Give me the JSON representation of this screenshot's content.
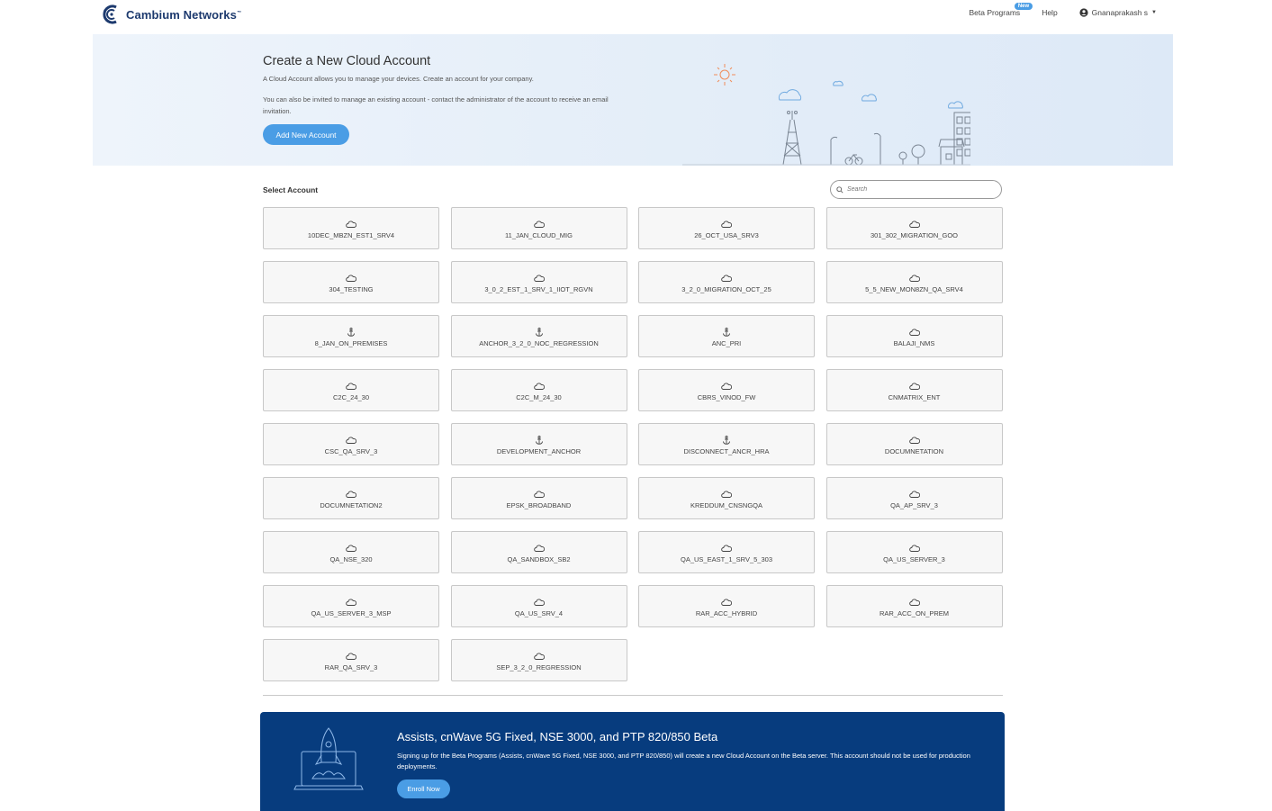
{
  "header": {
    "brand": "Cambium Networks",
    "brand_tm": "™",
    "beta_programs": "Beta Programs",
    "beta_badge": "New",
    "help": "Help",
    "user_name": "Gnanaprakash s"
  },
  "hero": {
    "title": "Create a New Cloud Account",
    "line1": "A Cloud Account allows you to manage your devices. Create an account for your company.",
    "line2": "You can also be invited to manage an existing account - contact the administrator of the account to receive an email invitation.",
    "add_button": "Add New Account"
  },
  "accounts": {
    "label": "Select Account",
    "search_placeholder": "Search",
    "items": [
      {
        "name": "10DEC_MBZN_EST1_SRV4",
        "icon": "cloud-icon"
      },
      {
        "name": "11_JAN_CLOUD_MIG",
        "icon": "cloud-icon"
      },
      {
        "name": "26_OCT_USA_SRV3",
        "icon": "cloud-icon"
      },
      {
        "name": "301_302_MIGRATION_GOO",
        "icon": "cloud-icon"
      },
      {
        "name": "304_TESTING",
        "icon": "cloud-icon"
      },
      {
        "name": "3_0_2_EST_1_SRV_1_IIOT_RGVN",
        "icon": "cloud-icon"
      },
      {
        "name": "3_2_0_MIGRATION_OCT_25",
        "icon": "cloud-icon"
      },
      {
        "name": "5_5_NEW_MON8ZN_QA_SRV4",
        "icon": "cloud-icon"
      },
      {
        "name": "8_JAN_ON_PREMISES",
        "icon": "anchor-icon"
      },
      {
        "name": "ANCHOR_3_2_0_NOC_REGRESSION",
        "icon": "anchor-icon"
      },
      {
        "name": "ANC_PRI",
        "icon": "anchor-icon"
      },
      {
        "name": "BALAJI_NMS",
        "icon": "cloud-icon"
      },
      {
        "name": "C2C_24_30",
        "icon": "cloud-icon"
      },
      {
        "name": "C2C_M_24_30",
        "icon": "cloud-icon"
      },
      {
        "name": "CBRS_VINOD_FW",
        "icon": "cloud-icon"
      },
      {
        "name": "CNMATRIX_ENT",
        "icon": "cloud-icon"
      },
      {
        "name": "CSC_QA_SRV_3",
        "icon": "cloud-icon"
      },
      {
        "name": "DEVELOPMENT_ANCHOR",
        "icon": "anchor-icon"
      },
      {
        "name": "DISCONNECT_ANCR_HRA",
        "icon": "anchor-icon"
      },
      {
        "name": "DOCUMNETATION",
        "icon": "cloud-icon"
      },
      {
        "name": "DOCUMNETATION2",
        "icon": "cloud-icon"
      },
      {
        "name": "EPSK_BROADBAND",
        "icon": "cloud-icon"
      },
      {
        "name": "KREDDUM_CNSNGQA",
        "icon": "cloud-icon"
      },
      {
        "name": "QA_AP_SRV_3",
        "icon": "cloud-icon"
      },
      {
        "name": "QA_NSE_320",
        "icon": "cloud-icon"
      },
      {
        "name": "QA_SANDBOX_SB2",
        "icon": "cloud-icon"
      },
      {
        "name": "QA_US_EAST_1_SRV_5_303",
        "icon": "cloud-icon"
      },
      {
        "name": "QA_US_SERVER_3",
        "icon": "cloud-icon"
      },
      {
        "name": "QA_US_SERVER_3_MSP",
        "icon": "cloud-icon"
      },
      {
        "name": "QA_US_SRV_4",
        "icon": "cloud-icon"
      },
      {
        "name": "RAR_ACC_HYBRID",
        "icon": "cloud-icon"
      },
      {
        "name": "RAR_ACC_ON_PREM",
        "icon": "cloud-icon"
      },
      {
        "name": "RAR_QA_SRV_3",
        "icon": "cloud-icon"
      },
      {
        "name": "SEP_3_2_0_REGRESSION",
        "icon": "cloud-icon"
      }
    ]
  },
  "beta": {
    "title": "Assists, cnWave 5G Fixed, NSE 3000, and PTP 820/850 Beta",
    "text": "Signing up for the Beta Programs (Assists, cnWave 5G Fixed, NSE 3000, and PTP 820/850) will create a new Cloud Account on the Beta server. This account should not be used for production deployments.",
    "enroll_button": "Enroll Now"
  },
  "colors": {
    "accent": "#4a9de5",
    "brand_dark": "#1d3a6e",
    "banner": "#073c7e"
  }
}
